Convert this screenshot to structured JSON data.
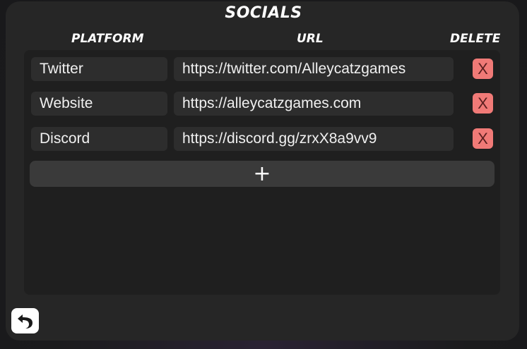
{
  "header": {
    "title": "SOCIALS"
  },
  "columns": {
    "platform": "PLATFORM",
    "url": "URL",
    "delete": "DELETE"
  },
  "rows": [
    {
      "platform": "Twitter",
      "url": "https://twitter.com/Alleycatzgames",
      "delete_label": "X"
    },
    {
      "platform": "Website",
      "url": "https://alleycatzgames.com",
      "delete_label": "X"
    },
    {
      "platform": "Discord",
      "url": "https://discord.gg/zrxX8a9vv9",
      "delete_label": "X"
    }
  ],
  "actions": {
    "add_label": "+",
    "back_icon": "undo-arrow-icon"
  },
  "colors": {
    "panel": "#262626",
    "delete_button": "#f07a77",
    "add_button": "#3a3a3a"
  }
}
